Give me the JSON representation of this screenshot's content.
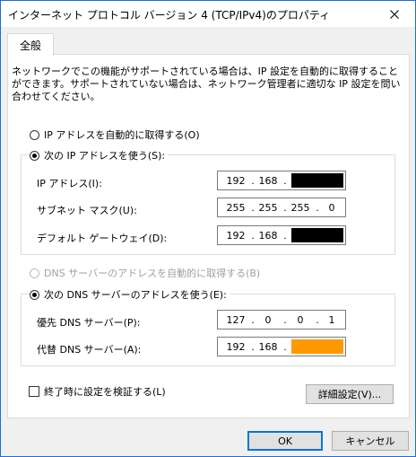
{
  "window": {
    "title": "インターネット プロトコル バージョン 4 (TCP/IPv4)のプロパティ"
  },
  "tab": {
    "label": "全般"
  },
  "description": "ネットワークでこの機能がサポートされている場合は、IP 設定を自動的に取得することができます。サポートされていない場合は、ネットワーク管理者に適切な IP 設定を問い合わせてください。",
  "ip_section": {
    "auto_label": "IP アドレスを自動的に取得する(O)",
    "auto_checked": false,
    "manual_label": "次の IP アドレスを使う(S):",
    "manual_checked": true,
    "fields": [
      {
        "label": "IP アドレス(I):",
        "octets": [
          "192",
          "168",
          "",
          ""
        ],
        "redaction_color": "#000000"
      },
      {
        "label": "サブネット マスク(U):",
        "octets": [
          "255",
          "255",
          "255",
          "0"
        ]
      },
      {
        "label": "デフォルト ゲートウェイ(D):",
        "octets": [
          "192",
          "168",
          "",
          ""
        ],
        "redaction_color": "#000000"
      }
    ]
  },
  "dns_section": {
    "auto_label": "DNS サーバーのアドレスを自動的に取得する(B)",
    "auto_disabled": true,
    "manual_label": "次の DNS サーバーのアドレスを使う(E):",
    "manual_checked": true,
    "fields": [
      {
        "label": "優先 DNS サーバー(P):",
        "octets": [
          "127",
          "0",
          "0",
          "1"
        ]
      },
      {
        "label": "代替 DNS サーバー(A):",
        "octets": [
          "192",
          "168",
          "",
          ""
        ],
        "redaction_color": "#ff9900"
      }
    ]
  },
  "validate": {
    "label": "終了時に設定を検証する(L)",
    "checked": false
  },
  "buttons": {
    "advanced": "詳細設定(V)...",
    "ok": "OK",
    "cancel": "キャンセル"
  }
}
